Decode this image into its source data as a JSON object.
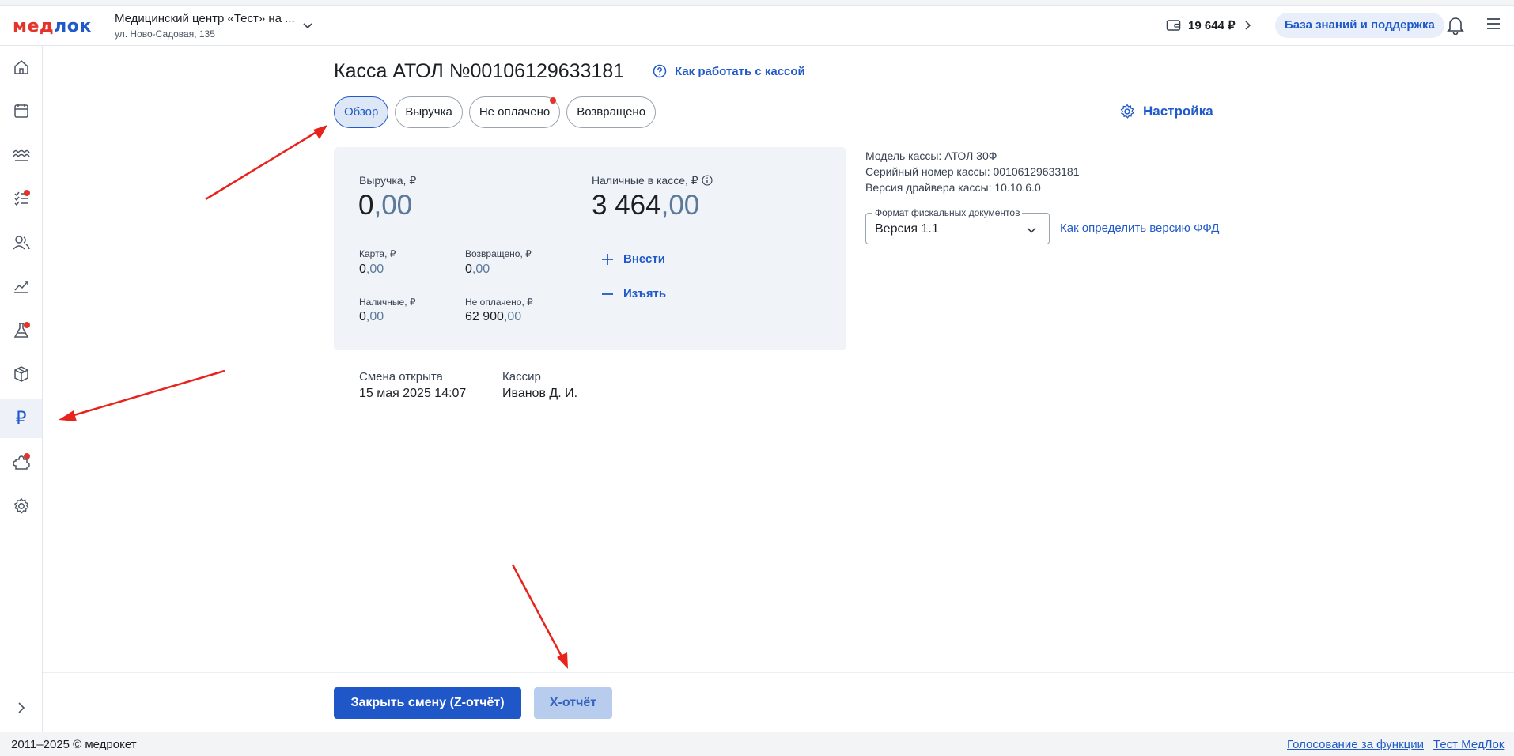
{
  "header": {
    "logo_part1": "мед",
    "logo_part2": "лок",
    "clinic_name": "Медицинский центр «Тест» на ...",
    "clinic_address": "ул. Ново-Садовая, 135",
    "balance": "19 644 ₽",
    "help_label": "База знаний и поддержка"
  },
  "sidebar": {
    "items": [
      {
        "icon": "home-icon"
      },
      {
        "icon": "calendar-icon"
      },
      {
        "icon": "services-icon"
      },
      {
        "icon": "tasks-icon",
        "badge": true
      },
      {
        "icon": "patients-icon"
      },
      {
        "icon": "analytics-icon"
      },
      {
        "icon": "lab-icon",
        "badge": true
      },
      {
        "icon": "warehouse-icon"
      },
      {
        "icon": "cashbox-icon",
        "active": true,
        "glyph": "₽"
      },
      {
        "icon": "integrations-icon",
        "badge": true
      },
      {
        "icon": "settings-icon"
      }
    ]
  },
  "page": {
    "title": "Касса АТОЛ №00106129633181",
    "howto_link": "Как работать с кассой",
    "settings_label": "Настройка"
  },
  "tabs": [
    {
      "label": "Обзор",
      "active": true
    },
    {
      "label": "Выручка"
    },
    {
      "label": "Не оплачено",
      "badge": true
    },
    {
      "label": "Возвращено"
    }
  ],
  "summary": {
    "revenue_label": "Выручка, ₽",
    "revenue_int": "0",
    "revenue_dec": ",00",
    "cash_in_register_label": "Наличные в кассе, ₽",
    "cash_in_register_int": "3 464",
    "cash_in_register_dec": ",00",
    "card_label": "Карта, ₽",
    "card_int": "0",
    "card_dec": ",00",
    "returned_label": "Возвращено, ₽",
    "returned_int": "0",
    "returned_dec": ",00",
    "cash_label": "Наличные, ₽",
    "cash_int": "0",
    "cash_dec": ",00",
    "unpaid_label": "Не оплачено, ₽",
    "unpaid_int": "62 900",
    "unpaid_dec": ",00",
    "deposit_label": "Внести",
    "withdraw_label": "Изъять"
  },
  "register_info": {
    "model": "Модель кассы: АТОЛ 30Ф",
    "serial": "Серийный номер кассы: 00106129633181",
    "driver": "Версия драйвера кассы: 10.10.6.0",
    "ffd_label": "Формат фискальных документов",
    "ffd_value": "Версия 1.1",
    "ffd_help_link": "Как определить версию ФФД"
  },
  "shift": {
    "opened_label": "Смена открыта",
    "opened_value": "15 мая 2025 14:07",
    "cashier_label": "Кассир",
    "cashier_value": "Иванов Д. И."
  },
  "actions": {
    "close_shift": "Закрыть смену (Z-отчёт)",
    "x_report": "Х-отчёт"
  },
  "footer": {
    "copyright": "2011–2025 © медрокет",
    "vote_link": "Голосование за функции",
    "test_link": "Тест МедЛок"
  },
  "colors": {
    "accent": "#2059c9",
    "brand_red": "#e4332b",
    "annotation_arrow": "#e8231b"
  }
}
